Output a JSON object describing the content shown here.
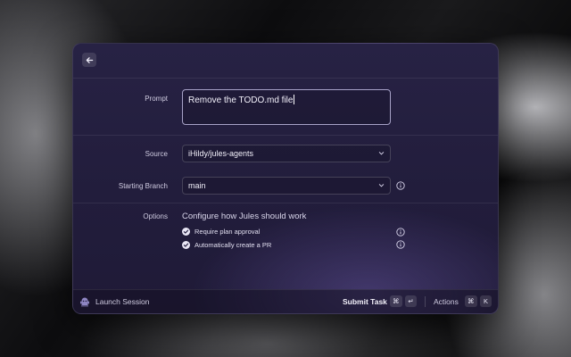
{
  "form": {
    "prompt_label": "Prompt",
    "prompt_value": "Remove the TODO.md file",
    "source_label": "Source",
    "source_value": "iHildy/jules-agents",
    "branch_label": "Starting Branch",
    "branch_value": "main",
    "options_label": "Options",
    "options_title": "Configure how Jules should work",
    "options": [
      {
        "label": "Require plan approval",
        "checked": true
      },
      {
        "label": "Automatically create a PR",
        "checked": true
      }
    ]
  },
  "footer": {
    "launch_label": "Launch Session",
    "submit_label": "Submit Task",
    "submit_keys": [
      "⌘",
      "↵"
    ],
    "actions_label": "Actions",
    "actions_keys": [
      "⌘",
      "K"
    ]
  },
  "icons": {
    "back": "arrow-left-icon",
    "chevron": "chevron-down-icon",
    "info": "info-icon",
    "check": "check-icon",
    "robot": "robot-icon"
  },
  "colors": {
    "panel_bg": "#231e3e",
    "accent_border": "#a7a2c7",
    "text": "#e6e3f2"
  }
}
